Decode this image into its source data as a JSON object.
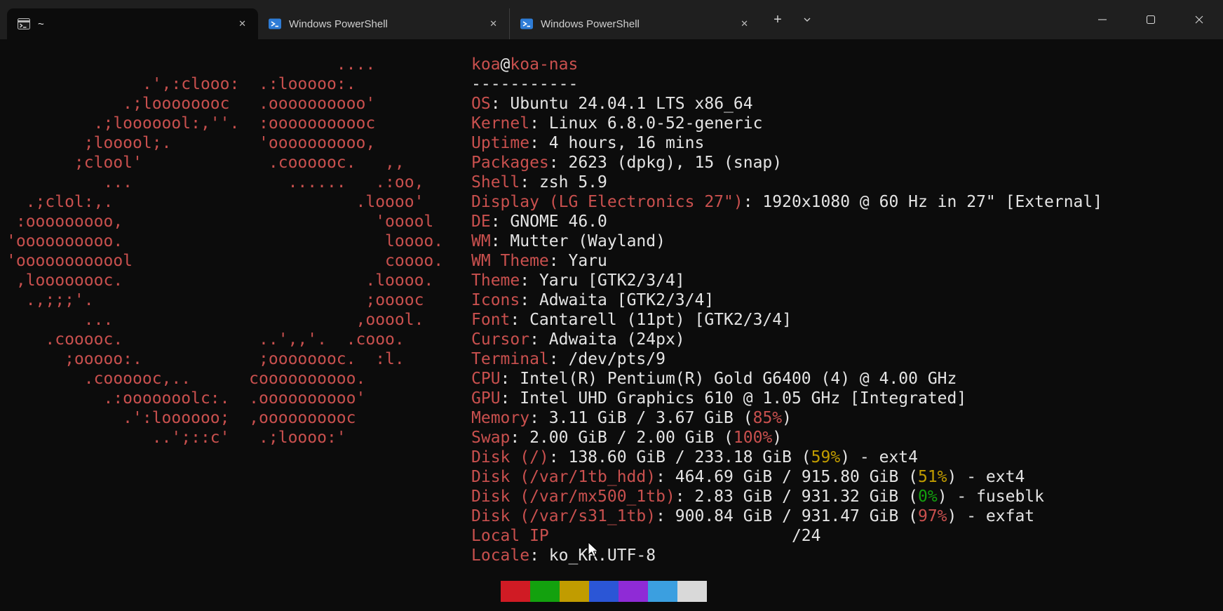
{
  "colors": {
    "background": "#0c0c0c",
    "titlebar_bg": "#1f1f1f",
    "foreground": "#e4e4e4",
    "accent_red": "#c9504e",
    "percent_yellow": "#c19c00",
    "percent_green": "#13a10e",
    "powershell_blue": "#2e7cd6",
    "tab_text": "#cfcfcf"
  },
  "titlebar": {
    "tabs": [
      {
        "label": "~",
        "icon": "terminal-icon",
        "active": true
      },
      {
        "label": "Windows PowerShell",
        "icon": "powershell-icon",
        "active": false
      },
      {
        "label": "Windows PowerShell",
        "icon": "powershell-icon",
        "active": false
      }
    ],
    "icons": {
      "close_tab": "✕",
      "new_tab": "+"
    }
  },
  "window_controls": {
    "minimize": "minimize",
    "maximize": "maximize",
    "close": "close"
  },
  "terminal": {
    "ascii_art": [
      "                                  ....",
      "              .',:clooo:  .:looooo:.",
      "            .;loooooooc   .oooooooooo'",
      "         .;looooool:,''.  :ooooooooooc",
      "        ;looool;.         'oooooooooo,",
      "       ;clool'             .coooooc.   ,,",
      "          ...                ......   .:oo,",
      "  .;clol:,.                         .loooo'",
      " :ooooooooo,                          'ooool",
      "'oooooooooo.                           loooo.",
      "'oooooooooool                          coooo.",
      " ,loooooooc.                         .loooo.",
      "  .,;;;'.                            ;ooooc",
      "        ...                         ,ooool.",
      "    .cooooc.              ..',,'.  .cooo.",
      "      ;ooooo:.            ;oooooooc.  :l.",
      "        .coooooc,..      coooooooooo.",
      "          .:ooooooolc:.  .oooooooooo'",
      "            .':loooooo;  ,oooooooooc",
      "               ..';::c'   .;loooo:'"
    ],
    "info_lines": [
      [
        [
          "koa",
          "k"
        ],
        [
          "@",
          "v"
        ],
        [
          "koa-nas",
          "k"
        ]
      ],
      [
        [
          "-----------",
          "v"
        ]
      ],
      [
        [
          "OS",
          "k"
        ],
        [
          ": Ubuntu 24.04.1 LTS x86_64",
          "v"
        ]
      ],
      [
        [
          "Kernel",
          "k"
        ],
        [
          ": Linux 6.8.0-52-generic",
          "v"
        ]
      ],
      [
        [
          "Uptime",
          "k"
        ],
        [
          ": 4 hours, 16 mins",
          "v"
        ]
      ],
      [
        [
          "Packages",
          "k"
        ],
        [
          ": 2623 (dpkg), 15 (snap)",
          "v"
        ]
      ],
      [
        [
          "Shell",
          "k"
        ],
        [
          ": zsh 5.9",
          "v"
        ]
      ],
      [
        [
          "Display (LG Electronics 27\")",
          "k"
        ],
        [
          ": 1920x1080 @ 60 Hz in 27\" [External]",
          "v"
        ]
      ],
      [
        [
          "DE",
          "k"
        ],
        [
          ": GNOME 46.0",
          "v"
        ]
      ],
      [
        [
          "WM",
          "k"
        ],
        [
          ": Mutter (Wayland)",
          "v"
        ]
      ],
      [
        [
          "WM Theme",
          "k"
        ],
        [
          ": Yaru",
          "v"
        ]
      ],
      [
        [
          "Theme",
          "k"
        ],
        [
          ": Yaru [GTK2/3/4]",
          "v"
        ]
      ],
      [
        [
          "Icons",
          "k"
        ],
        [
          ": Adwaita [GTK2/3/4]",
          "v"
        ]
      ],
      [
        [
          "Font",
          "k"
        ],
        [
          ": Cantarell (11pt) [GTK2/3/4]",
          "v"
        ]
      ],
      [
        [
          "Cursor",
          "k"
        ],
        [
          ": Adwaita (24px)",
          "v"
        ]
      ],
      [
        [
          "Terminal",
          "k"
        ],
        [
          ": /dev/pts/9",
          "v"
        ]
      ],
      [
        [
          "CPU",
          "k"
        ],
        [
          ": Intel(R) Pentium(R) Gold G6400 (4) @ 4.00 GHz",
          "v"
        ]
      ],
      [
        [
          "GPU",
          "k"
        ],
        [
          ": Intel UHD Graphics 610 @ 1.05 GHz [Integrated]",
          "v"
        ]
      ],
      [
        [
          "Memory",
          "k"
        ],
        [
          ": 3.11 GiB / 3.67 GiB (",
          "v"
        ],
        [
          "85%",
          "r"
        ],
        [
          ")",
          "v"
        ]
      ],
      [
        [
          "Swap",
          "k"
        ],
        [
          ": 2.00 GiB / 2.00 GiB (",
          "v"
        ],
        [
          "100%",
          "r"
        ],
        [
          ")",
          "v"
        ]
      ],
      [
        [
          "Disk (/)",
          "k"
        ],
        [
          ": 138.60 GiB / 233.18 GiB (",
          "v"
        ],
        [
          "59%",
          "y"
        ],
        [
          ") - ext4",
          "v"
        ]
      ],
      [
        [
          "Disk (/var/1tb_hdd)",
          "k"
        ],
        [
          ": 464.69 GiB / 915.80 GiB (",
          "v"
        ],
        [
          "51%",
          "y"
        ],
        [
          ") - ext4",
          "v"
        ]
      ],
      [
        [
          "Disk (/var/mx500_1tb)",
          "k"
        ],
        [
          ": 2.83 GiB / 931.32 GiB (",
          "v"
        ],
        [
          "0%",
          "g"
        ],
        [
          ") - fuseblk",
          "v"
        ]
      ],
      [
        [
          "Disk (/var/s31_1tb)",
          "k"
        ],
        [
          ": 900.84 GiB / 931.47 GiB (",
          "v"
        ],
        [
          "97%",
          "r"
        ],
        [
          ") - exfat",
          "v"
        ]
      ],
      [
        [
          "Local IP",
          "k"
        ],
        [
          "                         /24",
          "v"
        ]
      ],
      [
        [
          "Locale",
          "k"
        ],
        [
          ": ko_KR.UTF-8",
          "v"
        ]
      ]
    ],
    "palette": [
      "#0c0c0c",
      "#d01b24",
      "#13a10e",
      "#c19c00",
      "#2b56d6",
      "#8f2bd6",
      "#3b9fe0",
      "#d9d9d9"
    ]
  }
}
